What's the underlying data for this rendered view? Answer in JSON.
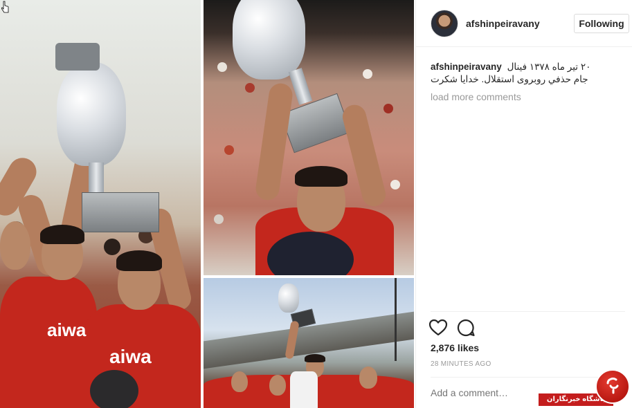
{
  "post": {
    "username": "afshinpeiravany",
    "follow_label": "Following",
    "caption_user": "afshinpeiravany",
    "caption_text": "۲۰ تیر ماه ۱۳۷۸ فینال جام حذفي روبروی استقلال. خدایا شکرت",
    "load_more": "load more comments",
    "likes": "2,876 likes",
    "time": "28 MINUTES AGO",
    "comment_placeholder": "Add a comment…",
    "icons": [
      "heart-icon",
      "comment-icon"
    ]
  },
  "photos": {
    "shirt_text_left": "aiwa",
    "shirt_text_left2": "aiwa"
  },
  "watermark": {
    "text": "باشگاه خبرنگاران"
  },
  "colors": {
    "accent_red": "#c41d1d",
    "text_primary": "#262626",
    "text_muted": "#999999",
    "border": "#dbdbdb"
  }
}
